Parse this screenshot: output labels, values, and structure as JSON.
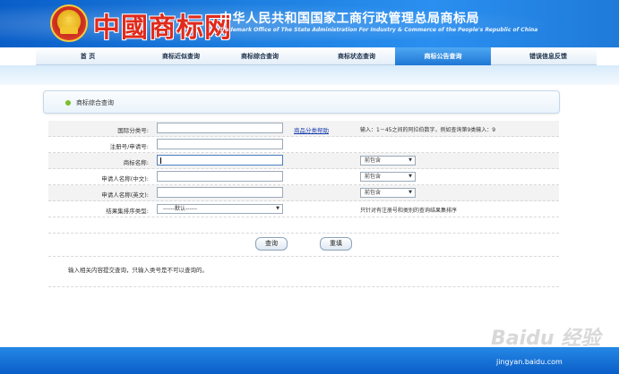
{
  "header": {
    "logo_text": "中國商标网",
    "title": "中华人民共和国国家工商行政管理总局商标局",
    "subtitle": "Trademark Office of The State Administration For Industry & Commerce of the People's Republic of China"
  },
  "nav": {
    "items": [
      {
        "label": "首  页"
      },
      {
        "label": "商标近似查询"
      },
      {
        "label": "商标综合查询"
      },
      {
        "label": "商标状态查询"
      },
      {
        "label": "商标公告查询"
      },
      {
        "label": "错误信息反馈"
      }
    ],
    "active_index": 4
  },
  "panel": {
    "title": "商标综合查询"
  },
  "form": {
    "rows": [
      {
        "label": "国际分类号:",
        "help_link": "商品分类帮助",
        "hint": "输入：1－45之间的阿拉伯数字，例如查询第9类输入：9"
      },
      {
        "label": "注册号/申请号:"
      },
      {
        "label": "商标名称:",
        "select": "前包含"
      },
      {
        "label": "申请人名称(中文):",
        "select": "前包含"
      },
      {
        "label": "申请人名称(英文):",
        "select": "前包含"
      },
      {
        "label": "结果集排序类型:",
        "select_value": "------默认------",
        "hint": "只针对有注册号和类别的查询结果集排序"
      }
    ]
  },
  "buttons": {
    "search": "查询",
    "reset": "重填"
  },
  "note": "输入相关内容提交查询，只输入类号是不可以查询的。",
  "watermark": {
    "main": "Baidu 经验",
    "sub": "jingyan.baidu.com"
  },
  "colors": {
    "header_blue": "#1d7fe0",
    "nav_active": "#2a8ff0",
    "logo_red": "#e02a1c"
  }
}
